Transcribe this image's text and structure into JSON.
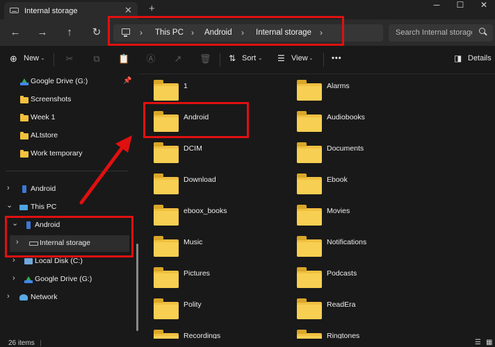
{
  "tab": {
    "title": "Internal storage"
  },
  "window": {
    "minimize": "─",
    "maximize": "☐",
    "close": "✕"
  },
  "nav": {
    "back": "←",
    "forward": "→",
    "up": "↑",
    "refresh": "↻"
  },
  "breadcrumb": [
    "This PC",
    "Android",
    "Internal storage"
  ],
  "search": {
    "placeholder": "Search Internal storage"
  },
  "toolbar": {
    "new_label": "New",
    "sort_label": "Sort",
    "view_label": "View",
    "more_label": "•••",
    "details_label": "Details"
  },
  "sidebar": {
    "quick_access": [
      {
        "label": "Google Drive (G:)",
        "pinned": true
      },
      {
        "label": "Screenshots"
      },
      {
        "label": "Week 1"
      },
      {
        "label": "ALtstore"
      },
      {
        "label": "Work temporary"
      }
    ],
    "tree": [
      {
        "label": "Android",
        "level": 0,
        "expanded": false
      },
      {
        "label": "This PC",
        "level": 0,
        "expanded": true
      },
      {
        "label": "Android",
        "level": 1,
        "expanded": true
      },
      {
        "label": "Internal storage",
        "level": 2,
        "expanded": false,
        "selected": true
      },
      {
        "label": "Local Disk (C:)",
        "level": 1,
        "expanded": false
      },
      {
        "label": "Google Drive (G:)",
        "level": 1,
        "expanded": false
      },
      {
        "label": "Network",
        "level": 0,
        "expanded": false
      }
    ]
  },
  "folders": [
    "1",
    "Alarms",
    "Android",
    "Audiobooks",
    "DCIM",
    "Documents",
    "Download",
    "Ebook",
    "eboox_books",
    "Movies",
    "Music",
    "Notifications",
    "Pictures",
    "Podcasts",
    "Polity",
    "ReadEra",
    "Recordings",
    "Ringtones"
  ],
  "status": {
    "item_count": "26 items"
  },
  "colors": {
    "annotation": "#e01010",
    "folder": "#f0c040",
    "background": "#191919"
  }
}
